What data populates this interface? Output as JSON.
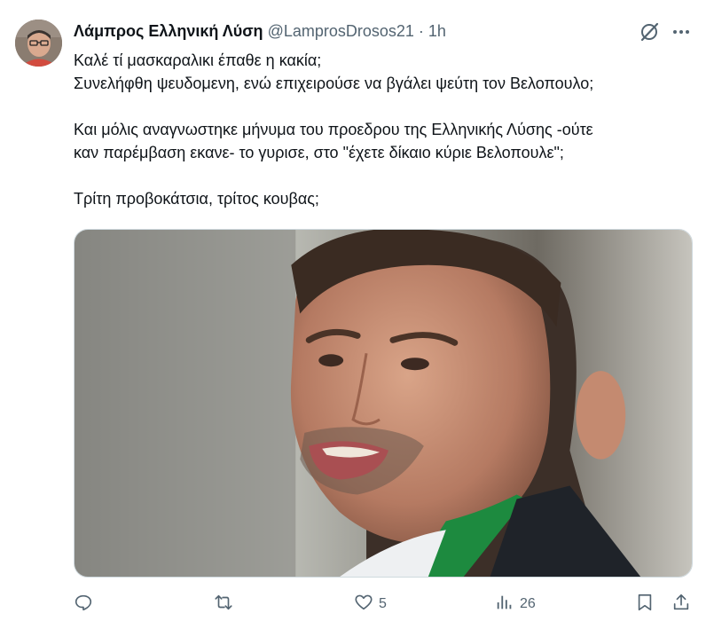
{
  "author": {
    "display_name": "Λάμπρος Ελληνική Λύση",
    "handle": "@LamprosDrosos21",
    "separator": "·",
    "time": "1h"
  },
  "tweet": {
    "lines_group1": [
      "Καλέ τί μασκαραλικι έπαθε η κακία;",
      "Συνελήφθη ψευδομενη, ενώ επιχειρούσε να βγάλει ψεύτη τον Βελοπουλο;"
    ],
    "lines_group2": [
      "Και μόλις αναγνωστηκε μήνυμα του προεδρου της Ελληνικής Λύσης -ούτε",
      "καν παρέμβαση εκανε- το γυρισε, στο \"έχετε δίκαιο κύριε Βελοπουλε\";"
    ],
    "lines_group3": [
      "Τρίτη προβοκάτσια, τρίτος κουβας;"
    ]
  },
  "media": {
    "type": "photo",
    "alt_icon": "portrait-photo"
  },
  "actions": {
    "reply": {
      "icon": "reply-icon",
      "count": ""
    },
    "retweet": {
      "icon": "retweet-icon",
      "count": ""
    },
    "like": {
      "icon": "heart-icon",
      "count": "5"
    },
    "views": {
      "icon": "views-icon",
      "count": "26"
    },
    "bookmark": {
      "icon": "bookmark-icon"
    },
    "share": {
      "icon": "share-icon"
    }
  },
  "colors": {
    "text": "#0f1419",
    "secondary": "#536471",
    "border": "#cfd9de"
  }
}
